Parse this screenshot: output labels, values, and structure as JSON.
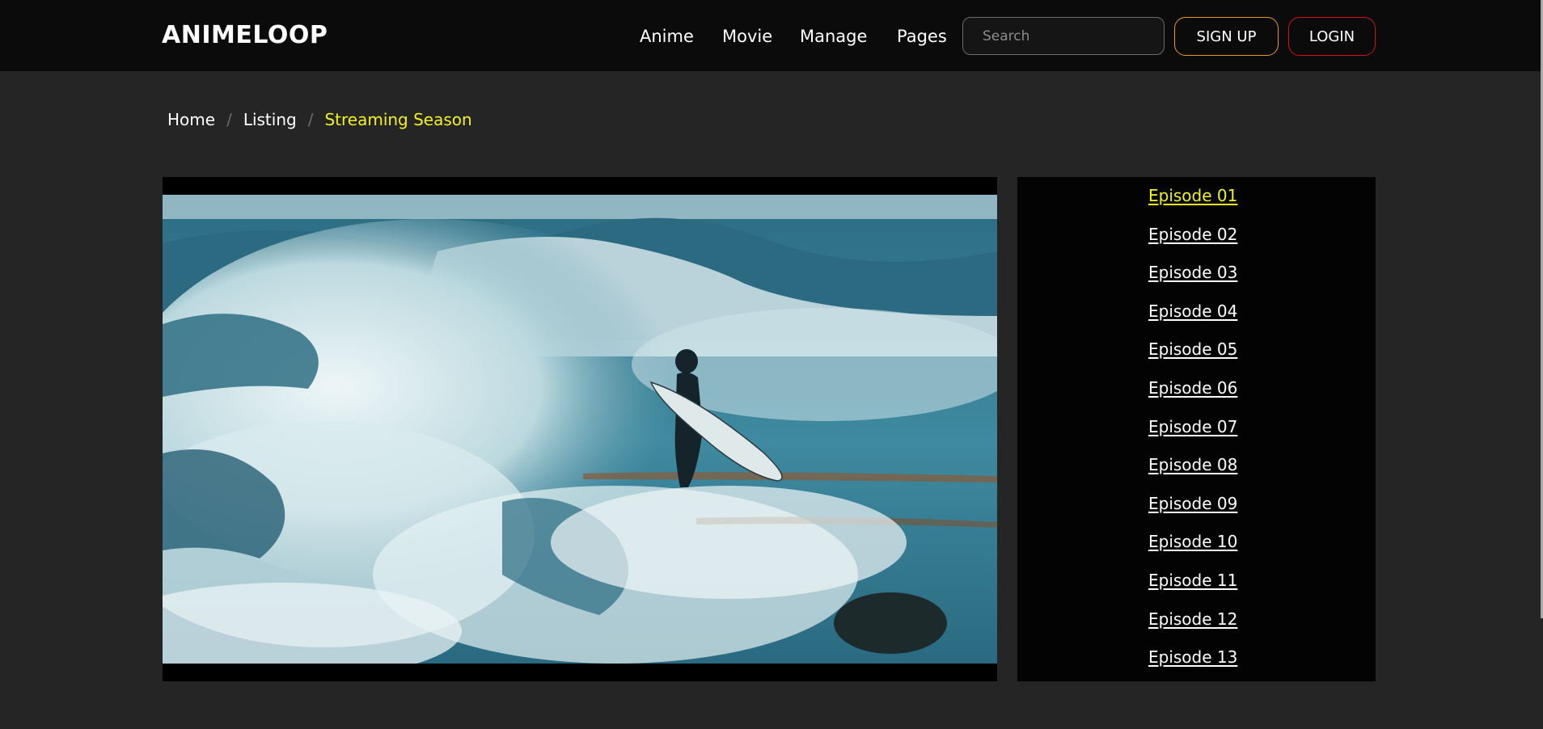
{
  "header": {
    "logo": "ANIMELOOP",
    "nav": [
      "Anime",
      "Movie",
      "Manage",
      "Pages"
    ],
    "search_placeholder": "Search",
    "signup_label": "SIGN UP",
    "login_label": "LOGIN"
  },
  "breadcrumb": [
    "Home",
    "Listing",
    "Streaming Season"
  ],
  "episodes": [
    "Episode 01",
    "Episode 02",
    "Episode 03",
    "Episode 04",
    "Episode 05",
    "Episode 06",
    "Episode 07",
    "Episode 08",
    "Episode 09",
    "Episode 10",
    "Episode 11",
    "Episode 12",
    "Episode 13"
  ],
  "colors": {
    "accent_yellow": "#f2f21c",
    "signup_border": "#e59a1e",
    "login_border": "#d31212",
    "background": "#252525",
    "header_bg": "#0b0b0b"
  }
}
